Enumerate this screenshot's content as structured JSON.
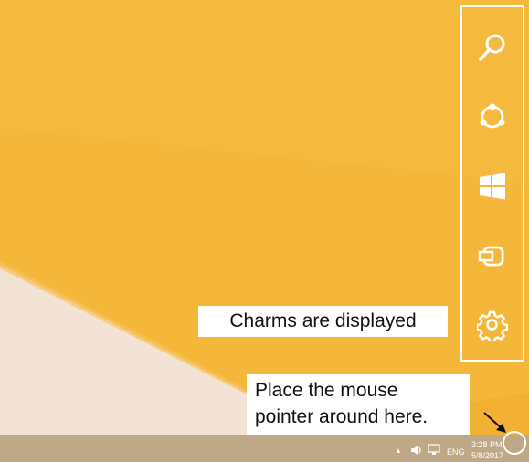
{
  "charms": [
    {
      "name": "Search",
      "icon": "search-icon"
    },
    {
      "name": "Share",
      "icon": "share-icon"
    },
    {
      "name": "Start",
      "icon": "windows-logo-icon"
    },
    {
      "name": "Devices",
      "icon": "devices-icon"
    },
    {
      "name": "Settings",
      "icon": "gear-icon"
    }
  ],
  "callouts": {
    "charms_displayed": "Charms are displayed",
    "pointer_line1": "Place the mouse",
    "pointer_line2": "pointer around here."
  },
  "taskbar": {
    "language": "ENG",
    "time": "3:28 PM",
    "date": "5/8/2017",
    "tray_icons": [
      "show-hidden-icons-arrow",
      "volume-icon",
      "network-icon"
    ]
  },
  "colors": {
    "desktop_orange": "#f4b73a",
    "desktop_light_orange": "#f7c24a",
    "desktop_cream": "#f2e3d4",
    "taskbar": "#bfa888",
    "outline": "#ffffff"
  }
}
